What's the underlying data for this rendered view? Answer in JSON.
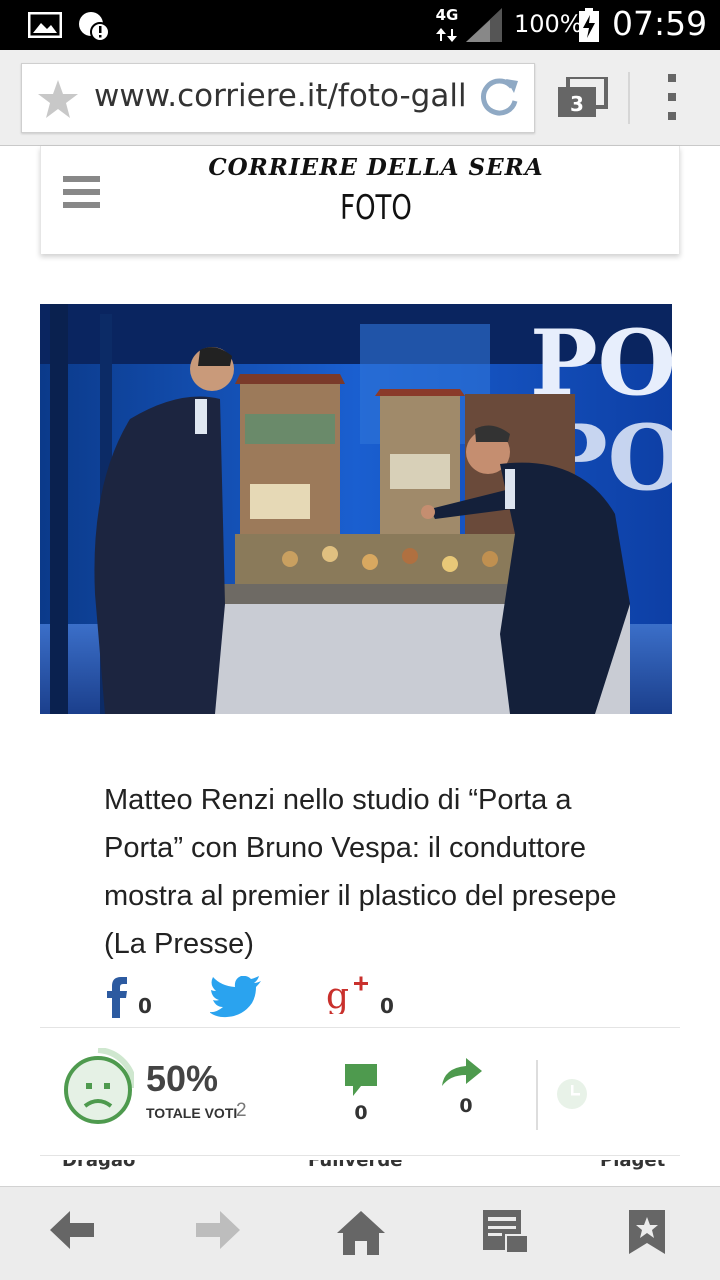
{
  "status_bar": {
    "network": "4G",
    "battery": "100%",
    "time": "07:59"
  },
  "browser": {
    "url": "www.corriere.it/foto-gall",
    "tab_count": "3"
  },
  "site": {
    "brand": "CORRIERE DELLA SERA",
    "section": "FOTO"
  },
  "photo": {
    "description_icon": "photo-of-studio-nativity"
  },
  "caption": "Matteo Renzi nello studio di “Porta a Porta” con Bruno Vespa: il conduttore mostra al premier il plastico del presepe (La Presse)",
  "share": {
    "facebook_count": "0",
    "googleplus_count": "0"
  },
  "votes": {
    "percent": "50%",
    "totale_label": "TOTALE VOTI",
    "totale_count": "2",
    "comments_count": "0",
    "shares_count": "0"
  },
  "ad_strip": {
    "texts": [
      "Dragao",
      "Fullverde",
      "Piaget"
    ]
  },
  "colors": {
    "green": "#4e9a4e",
    "twitter": "#2aa3ef",
    "facebook": "#2c5aa0",
    "googleplus": "#c9302c"
  }
}
